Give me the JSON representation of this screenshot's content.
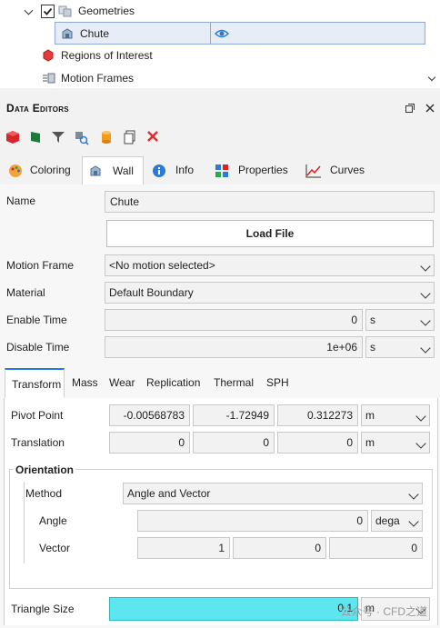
{
  "tree": {
    "geometries_label": "Geometries",
    "chute_label": "Chute",
    "regions_label": "Regions of Interest",
    "motion_frames_label": "Motion Frames"
  },
  "panel_header": {
    "title": "Data Editors"
  },
  "tabs": [
    "Coloring",
    "Wall",
    "Info",
    "Properties",
    "Curves"
  ],
  "form": {
    "name_label": "Name",
    "name_value": "Chute",
    "load_file_label": "Load File",
    "motion_frame_label": "Motion Frame",
    "motion_frame_value": "<No motion selected>",
    "material_label": "Material",
    "material_value": "Default Boundary",
    "enable_time_label": "Enable Time",
    "enable_time_value": "0",
    "enable_time_unit": "s",
    "disable_time_label": "Disable Time",
    "disable_time_value": "1e+06",
    "disable_time_unit": "s"
  },
  "subtabs": [
    "Transform",
    "Mass",
    "Wear",
    "Replication",
    "Thermal",
    "SPH"
  ],
  "transform": {
    "pivot_label": "Pivot Point",
    "pivot_values": [
      "-0.00568783",
      "-1.72949",
      "0.312273"
    ],
    "pivot_unit": "m",
    "translation_label": "Translation",
    "translation_values": [
      "0",
      "0",
      "0"
    ],
    "translation_unit": "m",
    "orientation_title": "Orientation",
    "method_label": "Method",
    "method_value": "Angle and Vector",
    "angle_label": "Angle",
    "angle_value": "0",
    "angle_unit": "dega",
    "vector_label": "Vector",
    "vector_values": [
      "1",
      "0",
      "0"
    ],
    "triangle_label": "Triangle Size",
    "triangle_value": "0.1",
    "triangle_unit": "m"
  },
  "watermark": "公众号 · CFD之道",
  "colors": {
    "accent": "#2b7bd6",
    "highlight": "#5ce6ef",
    "selection": "#e7edf6"
  }
}
